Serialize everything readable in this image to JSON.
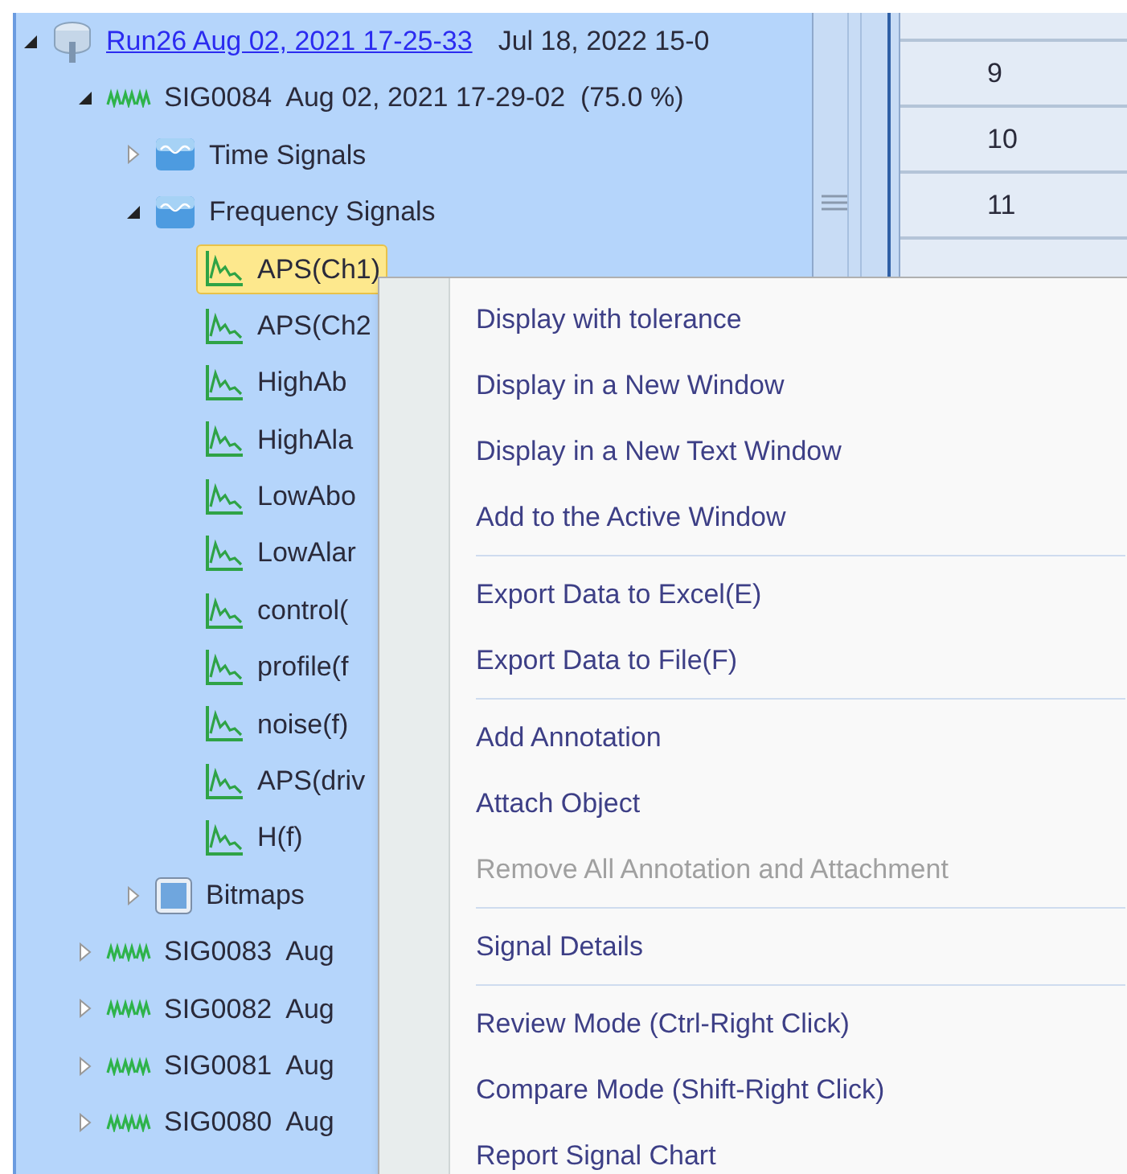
{
  "tree": [
    {
      "kind": "run",
      "label": "Run26 Aug 02, 2021 17-25-33",
      "detail": "Jul 18, 2022 15-0",
      "expanded": true,
      "selected": false,
      "children": [
        {
          "kind": "sig",
          "label": "SIG0084  Aug 02, 2021 17-29-02  (75.0 %)",
          "expanded": true,
          "selected": false,
          "children": [
            {
              "kind": "folder",
              "label": "Time Signals",
              "expanded": false,
              "selected": false
            },
            {
              "kind": "folder",
              "label": "Frequency Signals",
              "expanded": true,
              "selected": false,
              "children": [
                {
                  "kind": "signal",
                  "label": "APS(Ch1)",
                  "selected": true
                },
                {
                  "kind": "signal",
                  "label": "APS(Ch2",
                  "selected": false
                },
                {
                  "kind": "signal",
                  "label": "HighAb",
                  "selected": false
                },
                {
                  "kind": "signal",
                  "label": "HighAla",
                  "selected": false
                },
                {
                  "kind": "signal",
                  "label": "LowAbo",
                  "selected": false
                },
                {
                  "kind": "signal",
                  "label": "LowAlar",
                  "selected": false
                },
                {
                  "kind": "signal",
                  "label": "control(",
                  "selected": false
                },
                {
                  "kind": "signal",
                  "label": "profile(f",
                  "selected": false
                },
                {
                  "kind": "signal",
                  "label": "noise(f)",
                  "selected": false
                },
                {
                  "kind": "signal",
                  "label": "APS(driv",
                  "selected": false
                },
                {
                  "kind": "signal",
                  "label": "H(f)",
                  "selected": false
                }
              ]
            },
            {
              "kind": "bitmap",
              "label": "Bitmaps",
              "expanded": false,
              "selected": false
            }
          ]
        },
        {
          "kind": "sig",
          "label": "SIG0083  Aug",
          "expanded": false,
          "selected": false
        },
        {
          "kind": "sig",
          "label": "SIG0082  Aug",
          "expanded": false,
          "selected": false
        },
        {
          "kind": "sig",
          "label": "SIG0081  Aug",
          "expanded": false,
          "selected": false
        },
        {
          "kind": "sig",
          "label": "SIG0080  Aug",
          "expanded": false,
          "selected": false
        }
      ]
    }
  ],
  "table": {
    "rows": [
      "9",
      "10",
      "11"
    ]
  },
  "context_menu": [
    {
      "label": "Display with tolerance",
      "disabled": false,
      "separator_after": false
    },
    {
      "label": "Display in a New Window",
      "disabled": false,
      "separator_after": false
    },
    {
      "label": "Display in a New Text Window",
      "disabled": false,
      "separator_after": false
    },
    {
      "label": "Add to the Active Window",
      "disabled": false,
      "separator_after": true
    },
    {
      "label": "Export Data to Excel(E)",
      "disabled": false,
      "separator_after": false
    },
    {
      "label": "Export Data to File(F)",
      "disabled": false,
      "separator_after": true
    },
    {
      "label": "Add Annotation",
      "disabled": false,
      "separator_after": false
    },
    {
      "label": "Attach Object",
      "disabled": false,
      "separator_after": false
    },
    {
      "label": "Remove All Annotation and Attachment",
      "disabled": true,
      "separator_after": true
    },
    {
      "label": "Signal Details",
      "disabled": false,
      "separator_after": true
    },
    {
      "label": "Review Mode (Ctrl-Right Click)",
      "disabled": false,
      "separator_after": false
    },
    {
      "label": "Compare Mode (Shift-Right Click)",
      "disabled": false,
      "separator_after": false
    },
    {
      "label": "Report Signal Chart",
      "disabled": false,
      "separator_after": false
    }
  ]
}
